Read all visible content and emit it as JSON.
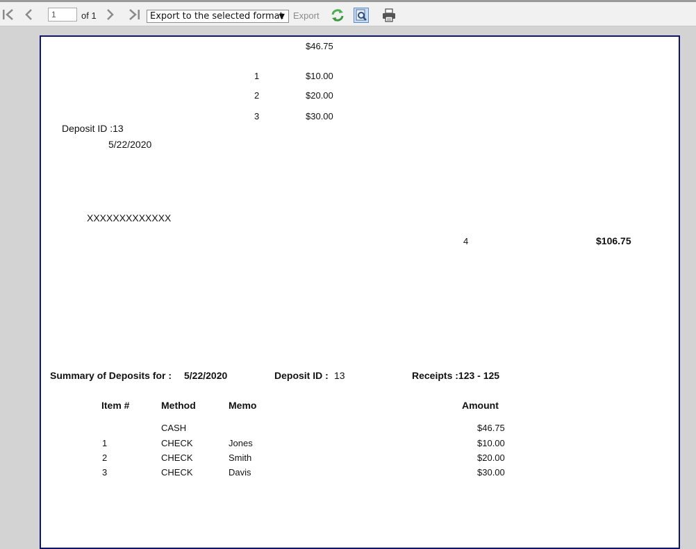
{
  "toolbar": {
    "page_value": "1",
    "page_of": "of 1",
    "export_format": "Export to the selected format",
    "export_arrow": "▼",
    "export_label": "Export"
  },
  "report": {
    "top": {
      "cash_amount": "$46.75",
      "items": [
        {
          "num": "1",
          "amount": "$10.00"
        },
        {
          "num": "2",
          "amount": "$20.00"
        },
        {
          "num": "3",
          "amount": "$30.00"
        }
      ],
      "deposit_id": "Deposit ID :13",
      "date": "5/22/2020",
      "account_mask": "XXXXXXXXXXXXX",
      "item_count": "4",
      "total": "$106.75"
    },
    "summary": {
      "title_label": "Summary of Deposits for :",
      "title_date": "5/22/2020",
      "deposit_label": "Deposit ID :",
      "deposit_value": "13",
      "receipts": "Receipts :123 - 125",
      "columns": {
        "item": "Item #",
        "method": "Method",
        "memo": "Memo",
        "amount": "Amount"
      },
      "rows": [
        {
          "item": "",
          "method": "CASH",
          "memo": "",
          "amount": "$46.75"
        },
        {
          "item": "1",
          "method": "CHECK",
          "memo": "Jones",
          "amount": "$10.00"
        },
        {
          "item": "2",
          "method": "CHECK",
          "memo": "Smith",
          "amount": "$20.00"
        },
        {
          "item": "3",
          "method": "CHECK",
          "memo": "Davis",
          "amount": "$30.00"
        }
      ]
    }
  }
}
